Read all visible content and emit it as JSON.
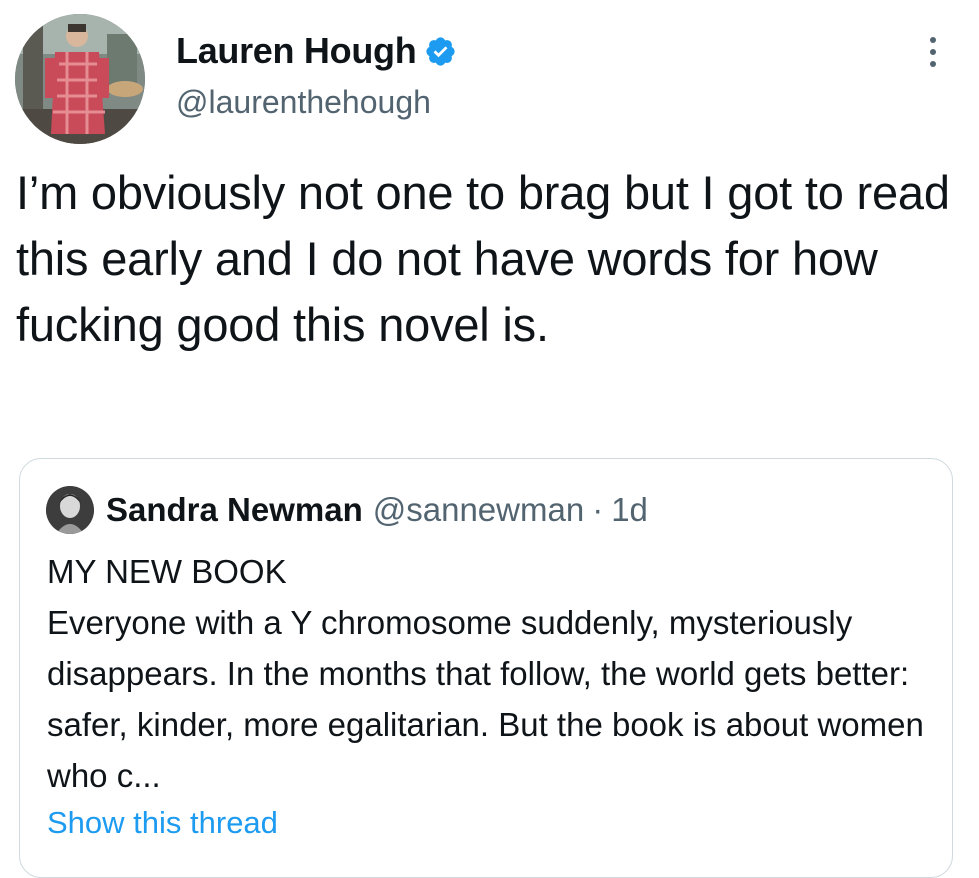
{
  "author": {
    "display_name": "Lauren Hough",
    "handle": "@laurenthehough",
    "verified": true
  },
  "tweet": {
    "text": "I’m obviously not one to brag but I got to read this early and I do not have words for how fucking good this novel is."
  },
  "quoted_tweet": {
    "display_name": "Sandra Newman",
    "handle": "@sannewman",
    "separator": "·",
    "time": "1d",
    "title": "MY NEW BOOK",
    "body": "Everyone with a Y chromosome suddenly, mysteriously disappears. In the months that follow, the world gets better: safer, kinder, more egalitarian. But the book is about women who c...",
    "show_thread_label": "Show this thread"
  },
  "colors": {
    "text": "#0f1419",
    "secondary": "#536471",
    "link": "#1d9bf0",
    "verified": "#1d9bf0",
    "border": "#cfd9de"
  },
  "icons": {
    "verified": "verified-badge-icon",
    "more": "more-options-icon"
  }
}
